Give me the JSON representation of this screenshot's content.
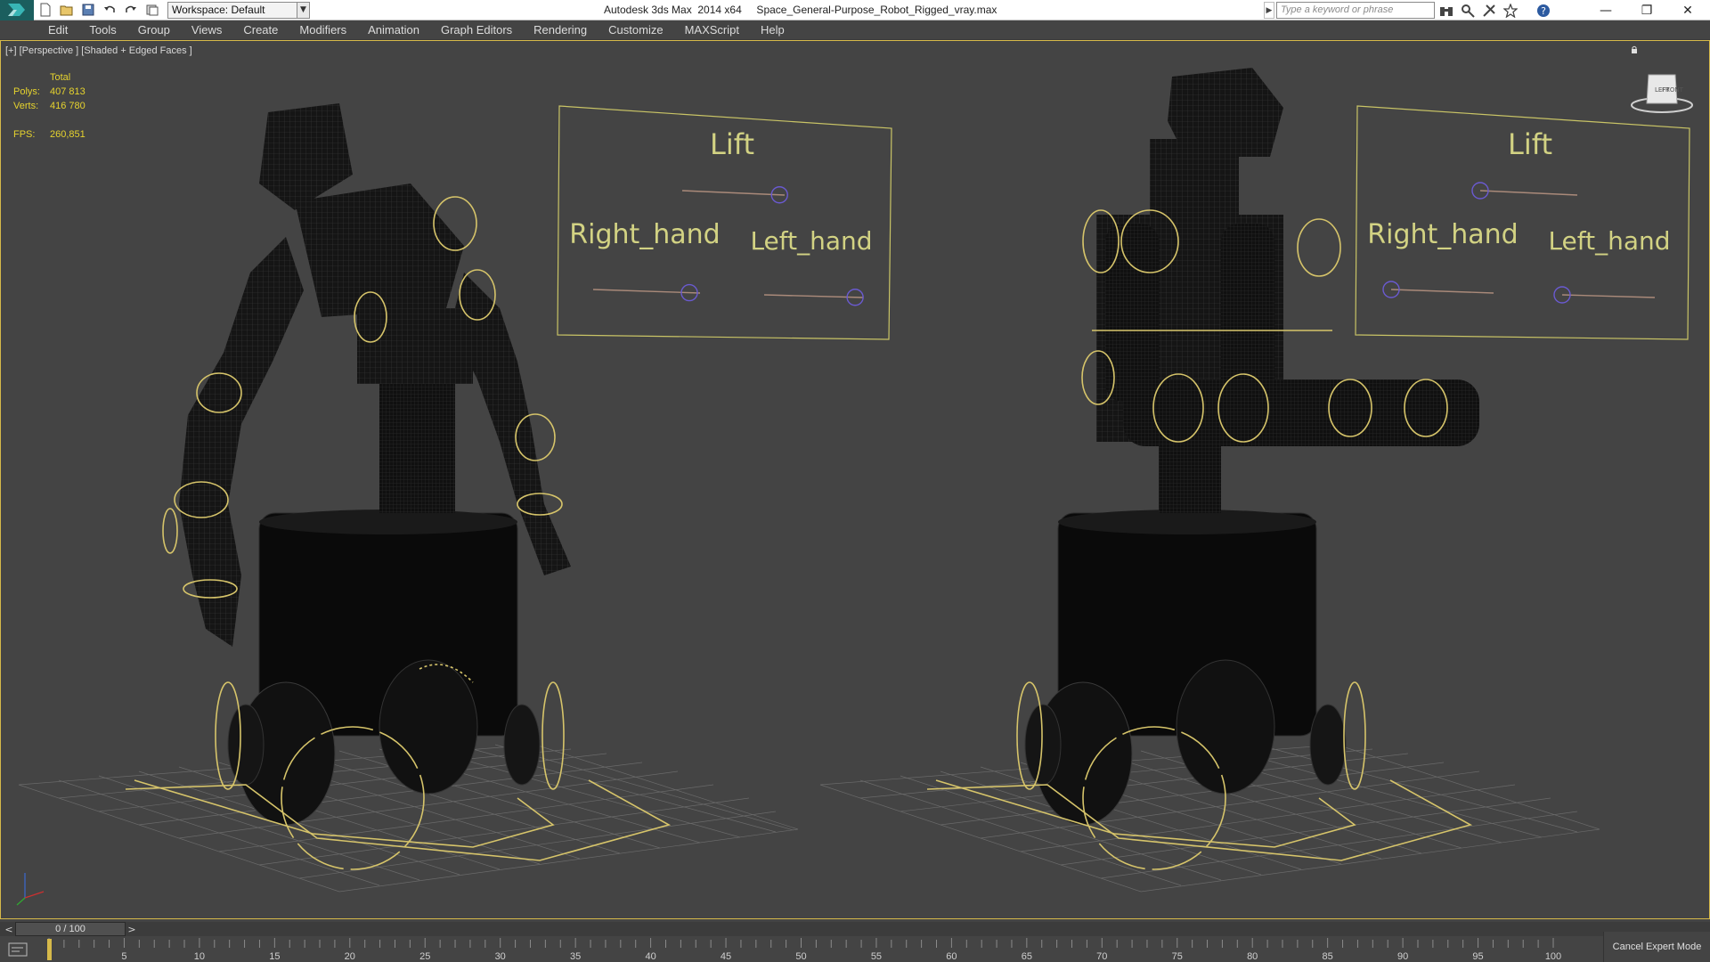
{
  "titlebar": {
    "workspace_label": "Workspace: Default",
    "window_title": "Autodesk 3ds Max  2014 x64     Space_General-Purpose_Robot_Rigged_vray.max",
    "search_placeholder": "Type a keyword or phrase",
    "icons": [
      "new-icon",
      "open-icon",
      "save-icon",
      "undo-icon",
      "redo-icon",
      "project-folder-icon",
      "binoculars-icon",
      "search-tools-icon",
      "subscription-icon",
      "favorites-icon",
      "help-icon"
    ]
  },
  "menu": {
    "items": [
      "Edit",
      "Tools",
      "Group",
      "Views",
      "Create",
      "Modifiers",
      "Animation",
      "Graph Editors",
      "Rendering",
      "Customize",
      "MAXScript",
      "Help"
    ]
  },
  "viewport": {
    "label": "[+] [Perspective ] [Shaded + Edged Faces ]",
    "stats": {
      "total_label": "Total",
      "polys_label": "Polys:",
      "polys_value": "407 813",
      "verts_label": "Verts:",
      "verts_value": "416 780",
      "fps_label": "FPS:",
      "fps_value": "260,851"
    },
    "viewcube_labels": [
      "LEFT",
      "FRONT"
    ]
  },
  "control_panels": [
    {
      "lift": "Lift",
      "right_hand": "Right_hand",
      "left_hand": "Left_hand",
      "lift_value": 0.95,
      "right_value": 0.9,
      "left_value": 0.92
    },
    {
      "lift": "Lift",
      "right_hand": "Right_hand",
      "left_hand": "Left_hand",
      "lift_value": 0.0,
      "right_value": 0.0,
      "left_value": 0.0
    }
  ],
  "timeline": {
    "position": "0 / 100",
    "prev": "<",
    "next": ">",
    "current_frame": 0,
    "ticks": [
      5,
      10,
      15,
      20,
      25,
      30,
      35,
      40,
      45,
      50,
      55,
      60,
      65,
      70,
      75,
      80,
      85,
      90,
      95,
      100
    ]
  },
  "status": {
    "cancel_expert_mode": "Cancel Expert Mode"
  },
  "colors": {
    "accent": "#d6b94a",
    "stats": "#e6d32e",
    "viewport_bg": "#444444"
  }
}
